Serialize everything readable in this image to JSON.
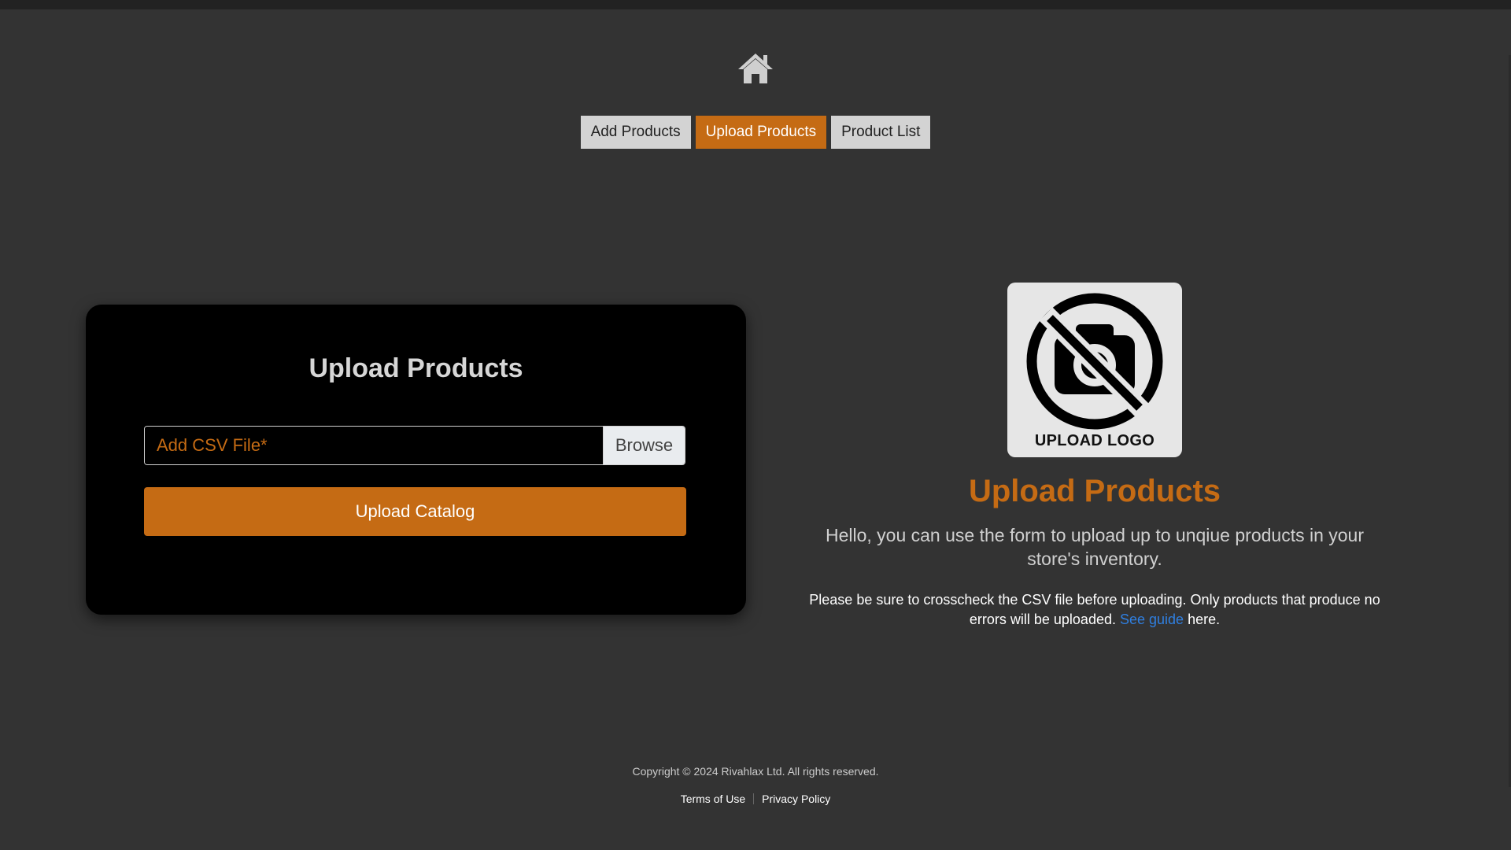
{
  "nav": {
    "home_icon": "home-icon",
    "tabs": [
      {
        "label": "Add Products",
        "active": false
      },
      {
        "label": "Upload Products",
        "active": true
      },
      {
        "label": "Product List",
        "active": false
      }
    ]
  },
  "form": {
    "title": "Upload Products",
    "file_placeholder": "Add CSV File*",
    "browse_label": "Browse",
    "submit_label": "Upload Catalog"
  },
  "info": {
    "logo_icon": "no-camera-icon",
    "logo_text": "UPLOAD LOGO",
    "title": "Upload Products",
    "description": "Hello, you can use the form to upload up to unqiue products in your store's inventory.",
    "note_before": "Please be sure to crosscheck the CSV file before uploading. Only products that produce no errors will be uploaded.",
    "note_link": "See guide",
    "note_after": "here."
  },
  "footer": {
    "copyright": "Copyright © 2024 Rivahlax Ltd. All rights reserved.",
    "links": [
      "Terms of Use",
      "Privacy Policy"
    ]
  },
  "colors": {
    "background": "#333333",
    "accent": "#c56b14",
    "card": "#000000",
    "link": "#2f7fe0"
  }
}
